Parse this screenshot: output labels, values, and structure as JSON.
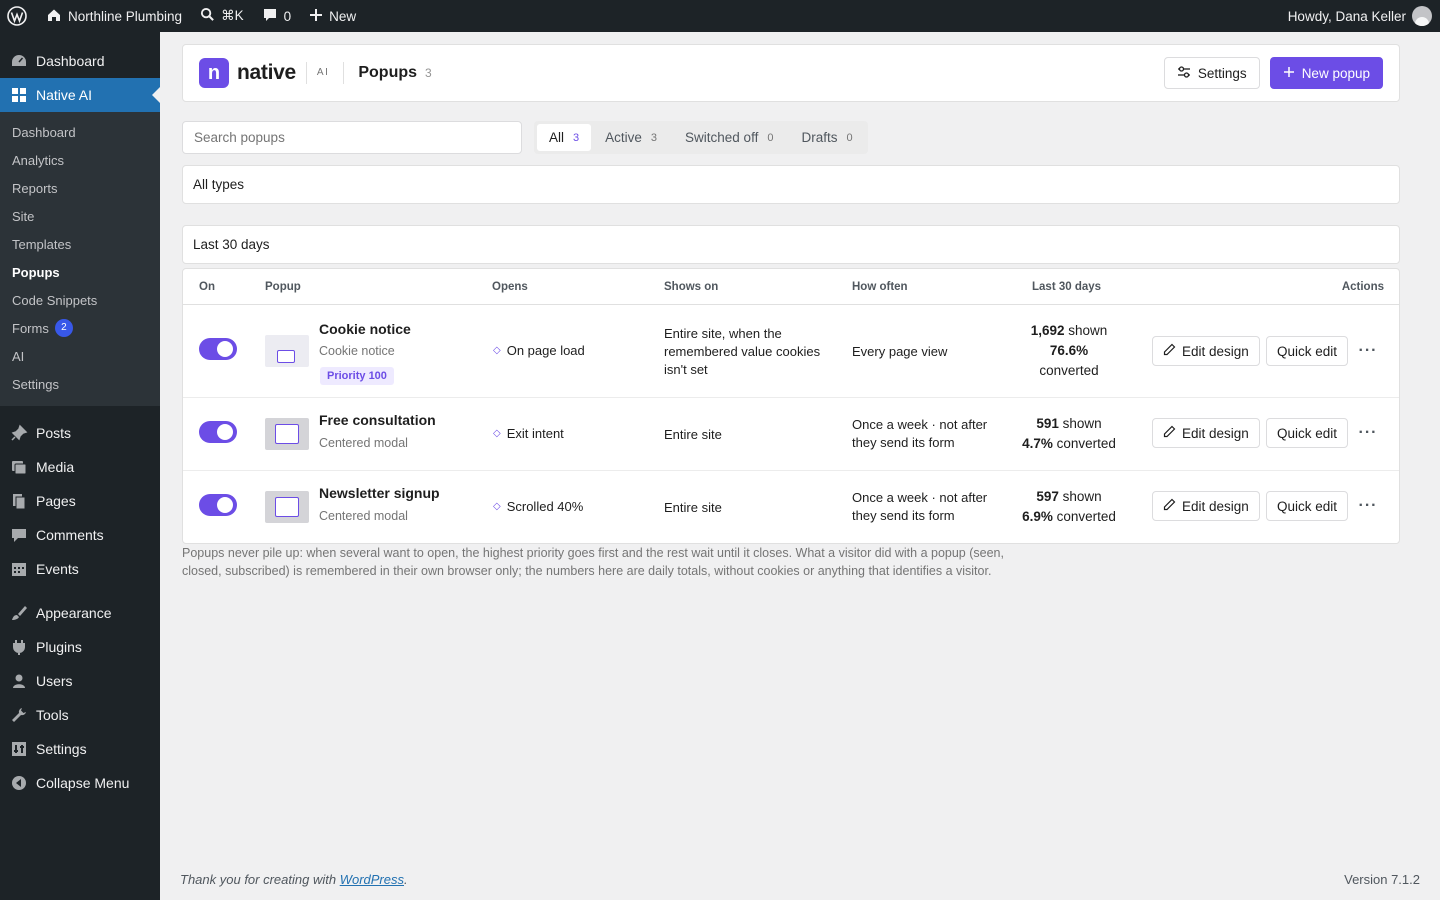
{
  "adminbar": {
    "site_name": "Northline Plumbing",
    "search_shortcut": "⌘K",
    "comments_count": "0",
    "new_label": "New",
    "howdy": "Howdy, Dana Keller"
  },
  "sidebar": {
    "top": [
      {
        "label": "Dashboard",
        "icon": "dashboard-icon"
      },
      {
        "label": "Native AI",
        "icon": "native-ai-icon",
        "current": true
      }
    ],
    "sub": [
      {
        "label": "Dashboard"
      },
      {
        "label": "Analytics"
      },
      {
        "label": "Reports"
      },
      {
        "label": "Site"
      },
      {
        "label": "Templates"
      },
      {
        "label": "Popups",
        "current": true
      },
      {
        "label": "Code Snippets"
      },
      {
        "label": "Forms",
        "badge": "2"
      },
      {
        "label": "AI"
      },
      {
        "label": "Settings"
      }
    ],
    "group2": [
      {
        "label": "Posts",
        "icon": "pin-icon"
      },
      {
        "label": "Media",
        "icon": "media-icon"
      },
      {
        "label": "Pages",
        "icon": "pages-icon"
      },
      {
        "label": "Comments",
        "icon": "comment-icon"
      },
      {
        "label": "Events",
        "icon": "calendar-icon"
      }
    ],
    "group3": [
      {
        "label": "Appearance",
        "icon": "brush-icon"
      },
      {
        "label": "Plugins",
        "icon": "plug-icon"
      },
      {
        "label": "Users",
        "icon": "user-icon"
      },
      {
        "label": "Tools",
        "icon": "wrench-icon"
      },
      {
        "label": "Settings",
        "icon": "settings-icon"
      },
      {
        "label": "Collapse Menu",
        "icon": "collapse-icon"
      }
    ]
  },
  "header": {
    "logo_letter": "n",
    "logo_word": "native",
    "ai_tag": "AI",
    "title": "Popups",
    "count": "3",
    "settings_label": "Settings",
    "new_popup_label": "New popup"
  },
  "search": {
    "placeholder": "Search popups"
  },
  "tabs": [
    {
      "label": "All",
      "count": "3",
      "active": true
    },
    {
      "label": "Active",
      "count": "3"
    },
    {
      "label": "Switched off",
      "count": "0"
    },
    {
      "label": "Drafts",
      "count": "0"
    }
  ],
  "filters": {
    "type": "All types",
    "period": "Last 30 days"
  },
  "table": {
    "headers": {
      "on": "On",
      "popup": "Popup",
      "opens": "Opens",
      "shows_on": "Shows on",
      "how_often": "How often",
      "last30": "Last 30 days",
      "actions": "Actions"
    },
    "rows": [
      {
        "enabled": true,
        "name": "Cookie notice",
        "type": "Cookie notice",
        "priority": "Priority 100",
        "opens": "On page load",
        "shows_on": "Entire site, when the remembered value cookies isn't set",
        "how_often": "Every page view",
        "shown": "1,692",
        "shown_suffix": "shown",
        "conv": "76.6%",
        "conv_suffix": "converted",
        "edit_label": "Edit design",
        "quick_label": "Quick edit"
      },
      {
        "enabled": true,
        "name": "Free consultation",
        "type": "Centered modal",
        "opens": "Exit intent",
        "shows_on": "Entire site",
        "how_often": "Once a week · not after they send its form",
        "shown": "591",
        "shown_suffix": "shown",
        "conv": "4.7%",
        "conv_suffix": "converted",
        "edit_label": "Edit design",
        "quick_label": "Quick edit"
      },
      {
        "enabled": true,
        "name": "Newsletter signup",
        "type": "Centered modal",
        "opens": "Scrolled 40%",
        "shows_on": "Entire site",
        "how_often": "Once a week · not after they send its form",
        "shown": "597",
        "shown_suffix": "shown",
        "conv": "6.9%",
        "conv_suffix": "converted",
        "edit_label": "Edit design",
        "quick_label": "Quick edit"
      }
    ]
  },
  "note": "Popups never pile up: when several want to open, the highest priority goes first and the rest wait until it closes. What a visitor did with a popup (seen, closed, subscribed) is remembered in their own browser only; the numbers here are daily totals, without cookies or anything that identifies a visitor.",
  "footer": {
    "thanks_prefix": "Thank you for creating with ",
    "thanks_link": "WordPress",
    "thanks_suffix": ".",
    "version": "Version 7.1.2"
  },
  "colors": {
    "accent": "#6c4de6",
    "wp_blue": "#2271b1",
    "admin_dark": "#1d2327"
  }
}
